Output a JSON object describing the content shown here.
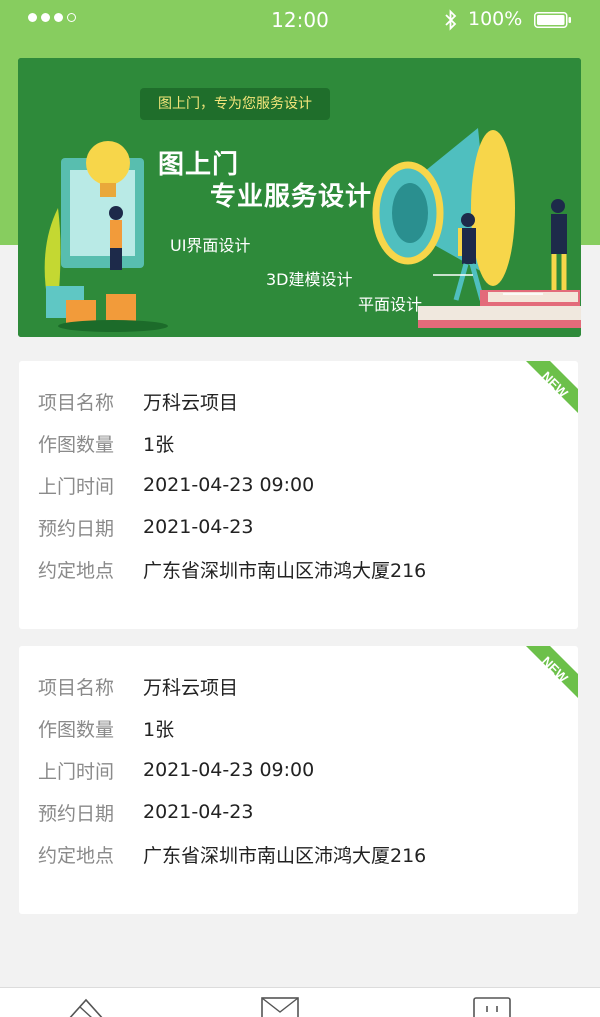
{
  "status_bar": {
    "time": "12:00",
    "battery": "100%",
    "bluetooth_icon": "bluetooth-icon",
    "battery_icon": "battery-icon"
  },
  "banner": {
    "pill_text": "图上门，专为您服务设计",
    "title_line1": "图上门",
    "title_line2": "专业服务设计",
    "service_1": "UI界面设计",
    "service_2": "3D建模设计",
    "service_3": "平面设计"
  },
  "orders": [
    {
      "badge": "NEW",
      "fields": [
        {
          "label": "项目名称",
          "value": "万科云项目"
        },
        {
          "label": "作图数量",
          "value": "1张"
        },
        {
          "label": "上门时间",
          "value": "2021-04-23  09:00"
        },
        {
          "label": "预约日期",
          "value": "2021-04-23"
        },
        {
          "label": "约定地点",
          "value": "广东省深圳市南山区沛鸿大厦216"
        }
      ]
    },
    {
      "badge": "NEW",
      "fields": [
        {
          "label": "项目名称",
          "value": "万科云项目"
        },
        {
          "label": "作图数量",
          "value": "1张"
        },
        {
          "label": "上门时间",
          "value": "2021-04-23  09:00"
        },
        {
          "label": "预约日期",
          "value": "2021-04-23"
        },
        {
          "label": "约定地点",
          "value": "广东省深圳市南山区沛鸿大厦216"
        }
      ]
    }
  ],
  "bottom_nav": {
    "items": [
      "home-icon",
      "mail-icon",
      "profile-icon"
    ]
  },
  "colors": {
    "accent_green": "#87cd5f",
    "banner_green": "#2e8a3a",
    "badge_green": "#6cc04a"
  }
}
